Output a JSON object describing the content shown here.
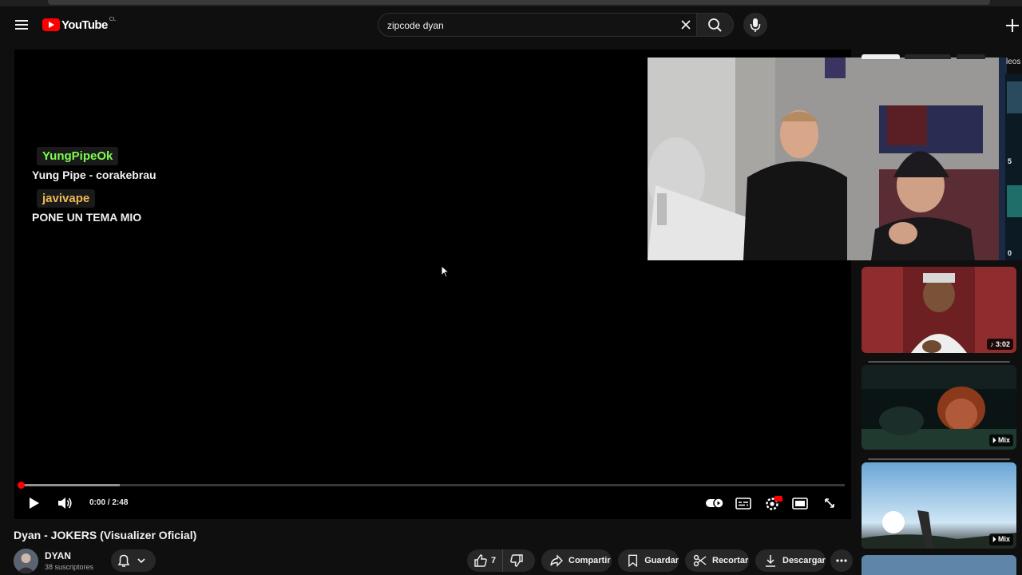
{
  "header": {
    "logo_text": "YouTube",
    "country_code": "CL",
    "search_value": "zipcode dyan",
    "icons": [
      "menu-icon",
      "clear-icon",
      "search-icon",
      "mic-icon",
      "create-icon"
    ]
  },
  "player": {
    "chat": [
      {
        "user": "YungPipeOk",
        "user_color": "#7cfc4e",
        "message": "Yung Pipe - corakebrau"
      },
      {
        "user": "javivape",
        "user_color": "#f0b955",
        "message": "PONE UN TEMA MIO"
      }
    ],
    "time_current": "0:00",
    "time_duration": "2:48",
    "progress_played": 0.0,
    "progress_buffered": 0.12,
    "settings_badge": "HD",
    "controls": [
      "play-icon",
      "volume-icon",
      "autoplay-toggle-icon",
      "subtitles-icon",
      "settings-icon",
      "miniplayer-icon",
      "fullscreen-icon"
    ]
  },
  "video": {
    "title": "Dyan - JOKERS (Visualizer Oficial)",
    "channel_name": "DYAN",
    "subscribers": "38 suscriptores"
  },
  "actions": {
    "like_count": "7",
    "share_label": "Compartir",
    "save_label": "Guardar",
    "clip_label": "Recortar",
    "download_label": "Descargar"
  },
  "sidebar": {
    "chips_partial": "leos",
    "edge_numbers": [
      "5",
      "0"
    ],
    "items": [
      {
        "badge": "3:02",
        "badge_icon": "music-note-icon"
      },
      {
        "badge": "Mix",
        "badge_icon": "mix-icon"
      },
      {
        "badge": "Mix",
        "badge_icon": "mix-icon"
      }
    ]
  },
  "colors": {
    "background": "#0f0f0f",
    "accent_red": "#ff0000",
    "pill_bg": "#272727"
  }
}
